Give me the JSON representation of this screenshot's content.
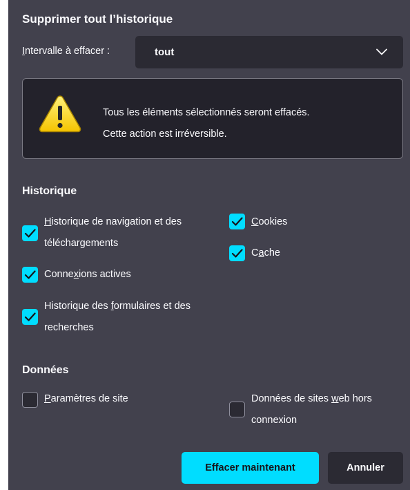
{
  "dialog": {
    "title": "Supprimer tout l’historique",
    "range": {
      "label_accesskey": "I",
      "label_rest": "ntervalle à effacer :",
      "value": "tout"
    },
    "warning": {
      "line1": "Tous les éléments sélectionnés seront effacés.",
      "line2": "Cette action est irréversible."
    },
    "history_section": {
      "title": "Historique",
      "items": [
        {
          "pre": "",
          "ak": "H",
          "post": "istorique de navigation et des",
          "line2": "téléchargements",
          "checked": true
        },
        {
          "pre": "",
          "ak": "C",
          "post": "ookies",
          "line2": "",
          "checked": true
        },
        {
          "pre": "C",
          "ak": "a",
          "post": "che",
          "line2": "",
          "checked": true
        },
        {
          "pre": "Conne",
          "ak": "x",
          "post": "ions actives",
          "line2": "",
          "checked": true
        },
        {
          "pre": "Historique des ",
          "ak": "f",
          "post": "ormulaires et des",
          "line2": "recherches",
          "checked": true
        }
      ]
    },
    "data_section": {
      "title": "Données",
      "items": [
        {
          "pre": "",
          "ak": "P",
          "post": "aramètres de site",
          "line2": "",
          "checked": false
        },
        {
          "pre": "Données de sites ",
          "ak": "w",
          "post": "eb hors",
          "line2": "connexion",
          "checked": false
        }
      ]
    },
    "buttons": {
      "primary": "Effacer maintenant",
      "secondary": "Annuler"
    }
  },
  "icons": {
    "warning": "warning-icon",
    "chevron": "chevron-down-icon",
    "check": "check-icon"
  },
  "colors": {
    "dialog_bg": "#42414d",
    "field_bg": "#2b2a33",
    "box_bg": "#23222b",
    "accent": "#00ddff",
    "text": "#fbfbfe",
    "warning_yellow": "#ffd530"
  }
}
